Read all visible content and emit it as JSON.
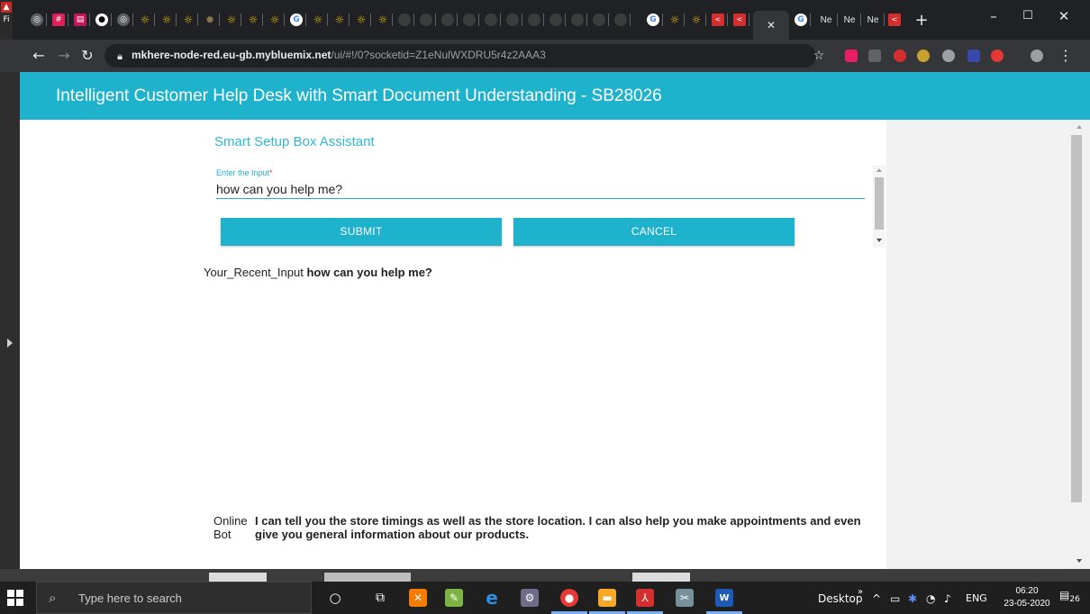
{
  "browser": {
    "url_host": "mkhere-node-red.eu-gb.mybluemix.net",
    "url_rest": "/ui/#!/0?socketid=Z1eNulWXDRU5r4z2AAA3",
    "tab_label_1": "Ne",
    "tab_label_2": "Ne",
    "tab_label_3": "Ne",
    "side_label": "Fi"
  },
  "page": {
    "header_title": "Intelligent Customer Help Desk with Smart Document Understanding - SB28026",
    "card_title": "Smart Setup Box Assistant",
    "input_label": "Enter the Input",
    "input_required_mark": "*",
    "input_value": "how can you help me?",
    "submit_label": "SUBMIT",
    "cancel_label": "CANCEL",
    "recent_prefix": "Your_Recent_Input",
    "recent_value": "how can you help me?",
    "bot_label": "Online Bot",
    "bot_message": "I can tell you the store timings as well as the store location. I can also help you make appointments and even give you general information about our products."
  },
  "taskbar": {
    "search_placeholder": "Type here to search",
    "desktop_label": "Desktop",
    "language": "ENG",
    "time": "06:20",
    "date": "23-05-2020",
    "notification_count": "26"
  },
  "colors": {
    "accent": "#1fb2cd",
    "title_accent": "#32b7d3"
  }
}
